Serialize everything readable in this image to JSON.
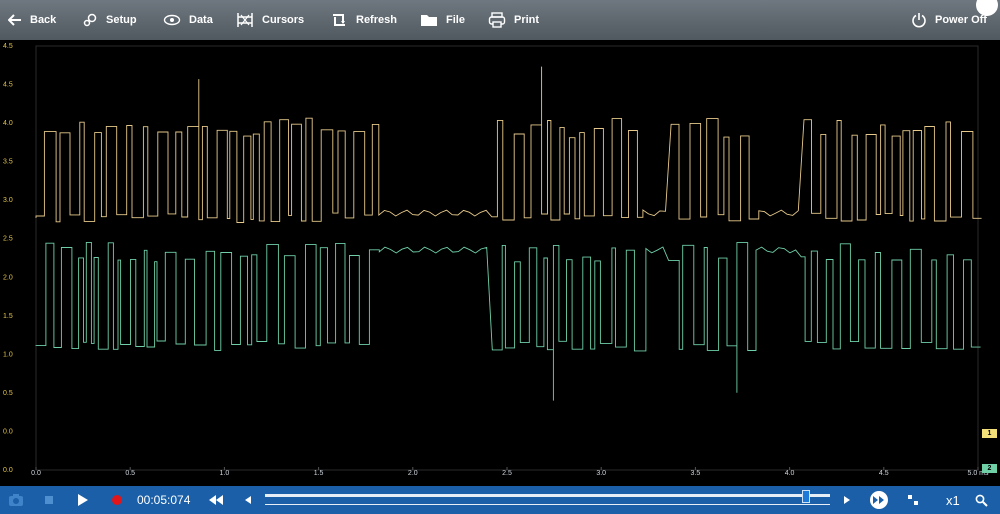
{
  "toolbar": {
    "back_label": "Back",
    "setup_label": "Setup",
    "data_label": "Data",
    "cursors_label": "Cursors",
    "refresh_label": "Refresh",
    "file_label": "File",
    "print_label": "Print",
    "power_label": "Power Off"
  },
  "colors": {
    "trace1": "#e6c98a",
    "trace2": "#6fd0a8",
    "axis_text": "#e4c54a",
    "toolbar_bg": "#5e676e",
    "bottombar_bg": "#1a5fa8"
  },
  "chart_data": {
    "type": "line",
    "x_ticks": [
      "0.0",
      "0.5",
      "1.0",
      "1.5",
      "2.0",
      "2.5",
      "3.0",
      "3.5",
      "4.0",
      "4.5",
      "5.0 ms"
    ],
    "y_ticks": [
      "0.0",
      "0.0",
      "0.5",
      "1.0",
      "1.5",
      "2.0",
      "2.5",
      "3.0",
      "3.5",
      "4.0",
      "4.5",
      "4.5"
    ],
    "xlim": [
      0,
      5.0
    ],
    "grid": true,
    "series": [
      {
        "id": "1",
        "tag": "1",
        "high": 3.6,
        "low": 2.9,
        "idle": 2.95
      },
      {
        "id": "2",
        "tag": "2",
        "high": 2.5,
        "low": 1.4,
        "idle": 2.5
      }
    ]
  },
  "playback": {
    "time": "00:05:074",
    "zoom": "x1",
    "position": 0.96
  }
}
